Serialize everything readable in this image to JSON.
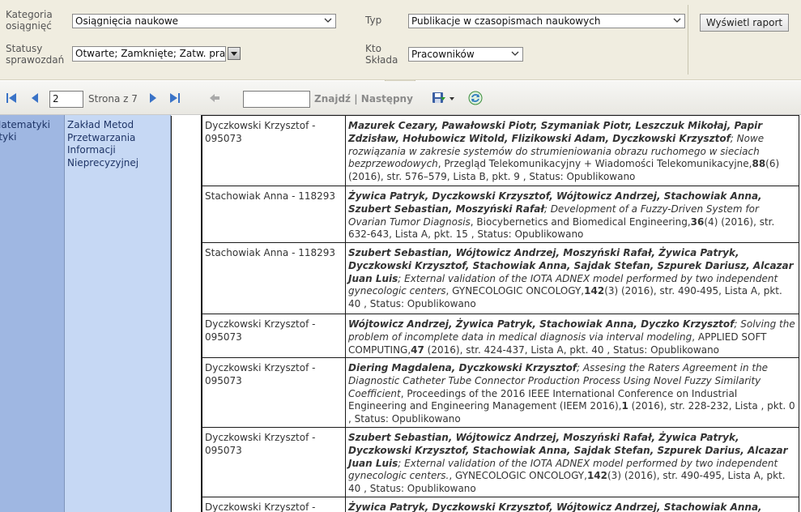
{
  "params": {
    "kategoria_label": "Kategoria osiągnięć",
    "kategoria_value": "Osiągnięcia naukowe",
    "typ_label": "Typ",
    "typ_value": "Publikacje w czasopismach naukowych",
    "statusy_label": "Statusy sprawozdań",
    "statusy_value": "Otwarte; Zamknięte; Zatw. pra",
    "kto_label": "Kto Składa",
    "kto_value": "Pracowników",
    "report_button": "Wyświetl raport"
  },
  "toolbar": {
    "page_value": "2",
    "page_of": "Strona z 7",
    "find_label": "Znajdź",
    "separator": "|",
    "next_label": "Następny"
  },
  "report": {
    "wydzial": "Matematyki atyki",
    "zaklad": "Zakład Metod Przetwarzania Informacji Nieprecyzyjnej",
    "rows": [
      {
        "person": "Dyczkowski Krzysztof - 095073",
        "authors": "Mazurek Cezary, Pawałowski Piotr, Szymaniak Piotr, Leszczuk Mikołaj, Papir Zdzisław, Hołubowicz Witold, Flizikowski Adam, Dyczkowski Krzysztof",
        "title": "Nowe rozwiązania w zakresie systemów do strumieniowania obrazu ruchomego w sieciach bezprzewodowych",
        "venue": ", Przegląd Telekomunikacyjny + Wiadomości Telekomunikacyjne,",
        "volume": "88",
        "details": "(6) (2016), str. 576–579, Lista B, pkt. 9 , Status: Opublikowano"
      },
      {
        "person": "Stachowiak Anna - 118293",
        "authors": "Żywica Patryk, Dyczkowski Krzysztof, Wójtowicz Andrzej, Stachowiak Anna, Szubert Sebastian, Moszyński Rafał",
        "title": "Development of a Fuzzy-Driven System for Ovarian Tumor Diagnosis",
        "venue": ", Biocybernetics and Biomedical Engineering,",
        "volume": "36",
        "details": "(4) (2016), str. 632-643, Lista A, pkt. 15 , Status: Opublikowano"
      },
      {
        "person": "Stachowiak Anna - 118293",
        "authors": "Szubert Sebastian, Wójtowicz Andrzej, Moszyński Rafał, Żywica Patryk, Dyczkowski Krzysztof, Stachowiak Anna, Sajdak Stefan, Szpurek Dariusz, Alcazar Juan Luis",
        "title": "External validation of the IOTA ADNEX model performed by two independent gynecologic centers",
        "venue": ", GYNECOLOGIC ONCOLOGY,",
        "volume": "142",
        "details": "(3) (2016), str. 490-495, Lista A, pkt. 40 , Status: Opublikowano"
      },
      {
        "person": "Dyczkowski Krzysztof - 095073",
        "authors": "Wójtowicz Andrzej, Żywica Patryk, Stachowiak Anna, Dyczko Krzysztof",
        "title": "Solving the problem of incomplete data in medical diagnosis via interval modeling",
        "venue": ", APPLIED SOFT COMPUTING,",
        "volume": "47",
        "details": " (2016), str. 424-437, Lista A, pkt. 40 , Status: Opublikowano"
      },
      {
        "person": "Dyczkowski Krzysztof - 095073",
        "authors": "Diering Magdalena, Dyczkowski Krzysztof",
        "title": "Assesing the Raters Agreement in the Diagnostic Catheter Tube Connector Production Process Using Novel Fuzzy Similarity Coefficient",
        "venue": ", Proceedings of the 2016 IEEE International Conference on Industrial Engineering and Engineering Management (IEEM 2016),",
        "volume": "1",
        "details": " (2016), str. 228-232, Lista , pkt. 0 , Status: Opublikowano"
      },
      {
        "person": "Dyczkowski Krzysztof - 095073",
        "authors": "Szubert Sebastian, Wójtowicz Andrzej, Moszyński Rafał, Żywica Patryk, Dyczkowski Krzysztof, Stachowiak Anna, Sajdak Stefan, Szpurek Darius, Alcazar Juan Luis",
        "title": "External validation of the IOTA ADNEX model performed by two independent gynecologic centers.",
        "venue": ", GYNECOLOGIC ONCOLOGY,",
        "volume": "142",
        "details": "(3) (2016), str. 490-495, Lista A, pkt. 40 , Status: Opublikowano"
      },
      {
        "person": "Dyczkowski Krzysztof -",
        "authors": "Żywica Patryk, Dyczkowski Krzysztof, Wójtowicz Andrzej, Stachowiak Anna,",
        "title": "",
        "venue": "",
        "volume": "",
        "details": ""
      }
    ]
  },
  "colors": {
    "param_bg": "#f0ede0",
    "wydzial_bg": "#9fb7e2",
    "zaklad_bg": "#c6d8f4",
    "link_text": "#1e3466"
  }
}
